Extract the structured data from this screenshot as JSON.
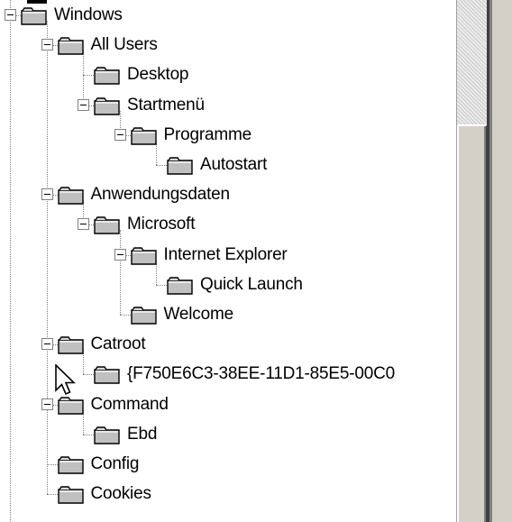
{
  "tree": {
    "nodes": [
      {
        "label": "Windows",
        "depth": 0,
        "expanded": true
      },
      {
        "label": "All Users",
        "depth": 1,
        "expanded": true
      },
      {
        "label": "Desktop",
        "depth": 2,
        "expanded": null
      },
      {
        "label": "Startmenü",
        "depth": 2,
        "expanded": true
      },
      {
        "label": "Programme",
        "depth": 3,
        "expanded": true
      },
      {
        "label": "Autostart",
        "depth": 4,
        "expanded": null
      },
      {
        "label": "Anwendungsdaten",
        "depth": 1,
        "expanded": true
      },
      {
        "label": "Microsoft",
        "depth": 2,
        "expanded": true
      },
      {
        "label": "Internet Explorer",
        "depth": 3,
        "expanded": true
      },
      {
        "label": "Quick Launch",
        "depth": 4,
        "expanded": null
      },
      {
        "label": "Welcome",
        "depth": 3,
        "expanded": null
      },
      {
        "label": "Catroot",
        "depth": 1,
        "expanded": true
      },
      {
        "label": "{F750E6C3-38EE-11D1-85E5-00C0",
        "depth": 2,
        "expanded": null
      },
      {
        "label": "Command",
        "depth": 1,
        "expanded": true
      },
      {
        "label": "Ebd",
        "depth": 2,
        "expanded": null
      },
      {
        "label": "Config",
        "depth": 1,
        "expanded": null
      },
      {
        "label": "Cookies",
        "depth": 1,
        "expanded": null
      }
    ]
  },
  "colors": {
    "folder_fill": "#c0c0c0",
    "folder_tab": "#d8d8d8",
    "folder_outline": "#000000",
    "connector": "#808080"
  },
  "icons": {
    "folder": "folder-icon",
    "toggle": "collapse-toggle-icon",
    "cursor": "mouse-pointer-icon"
  }
}
